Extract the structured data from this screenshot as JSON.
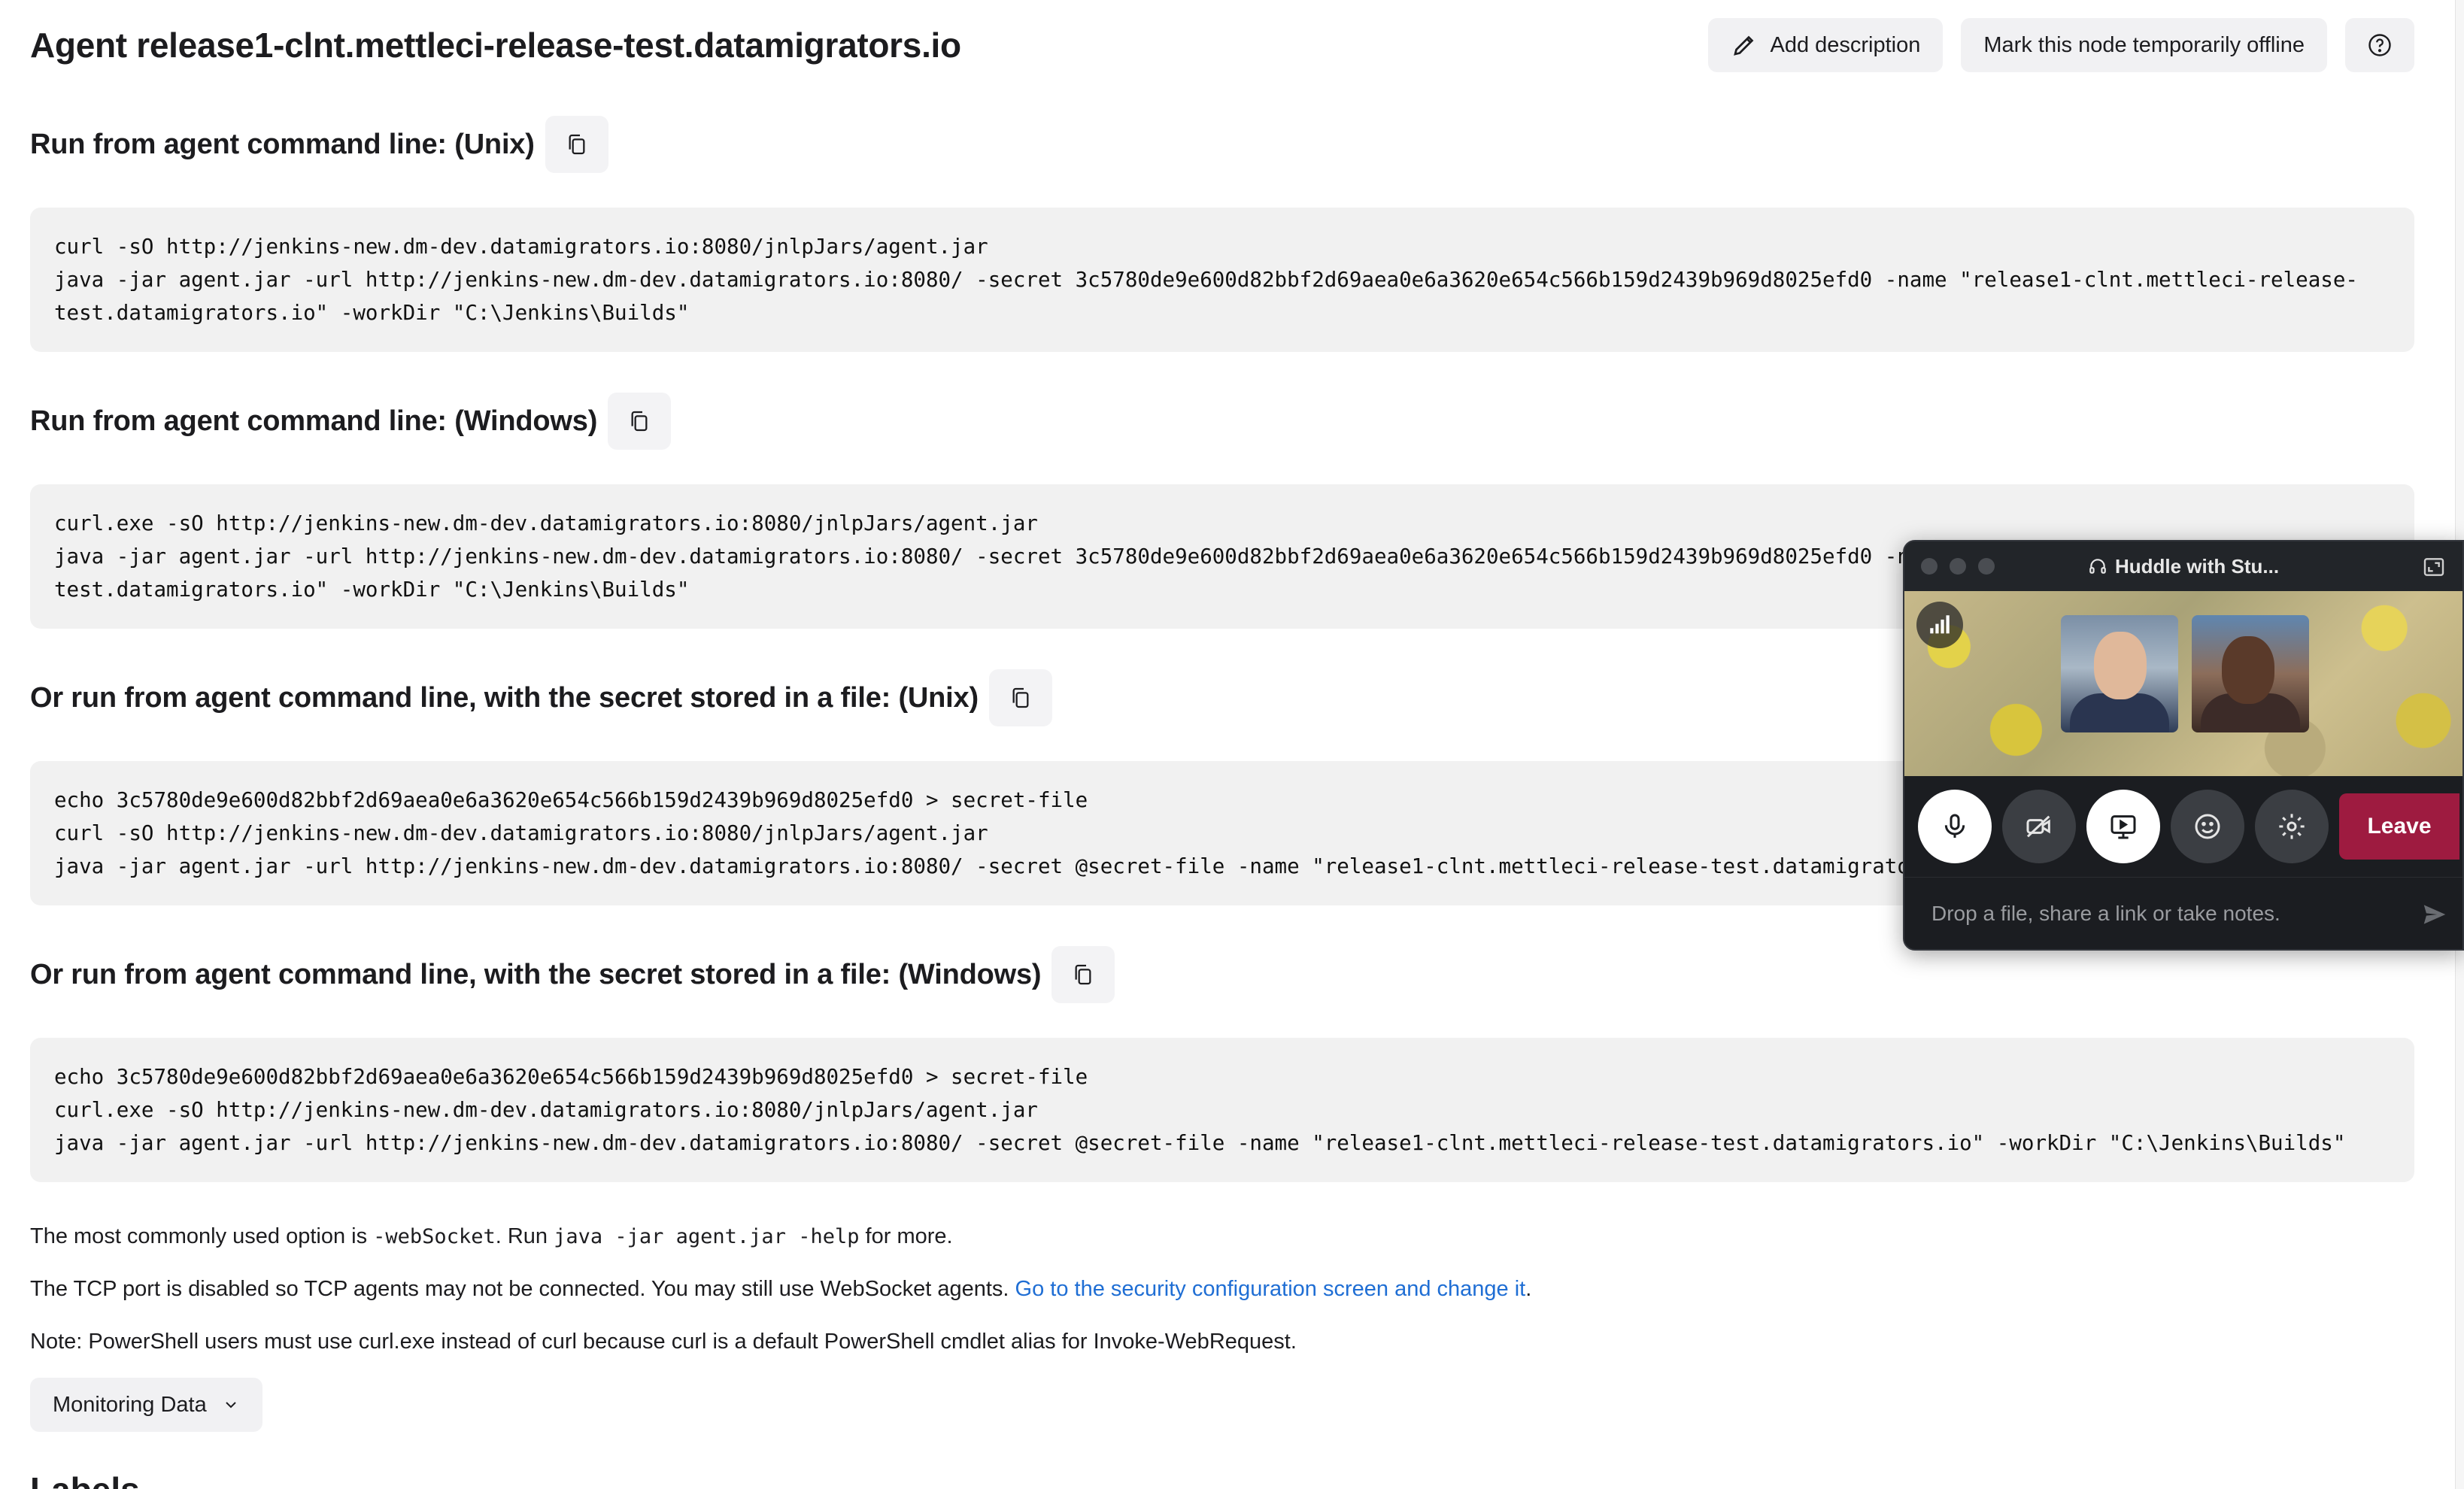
{
  "header": {
    "title": "Agent release1-clnt.mettleci-release-test.datamigrators.io",
    "add_description_label": "Add description",
    "offline_label": "Mark this node temporarily offline"
  },
  "sections": [
    {
      "title": "Run from agent command line: (Unix)",
      "code": "curl -sO http://jenkins-new.dm-dev.datamigrators.io:8080/jnlpJars/agent.jar\njava -jar agent.jar -url http://jenkins-new.dm-dev.datamigrators.io:8080/ -secret 3c5780de9e600d82bbf2d69aea0e6a3620e654c566b159d2439b969d8025efd0 -name \"release1-clnt.mettleci-release-\ntest.datamigrators.io\" -workDir \"C:\\Jenkins\\Builds\""
    },
    {
      "title": "Run from agent command line: (Windows)",
      "code": "curl.exe -sO http://jenkins-new.dm-dev.datamigrators.io:8080/jnlpJars/agent.jar\njava -jar agent.jar -url http://jenkins-new.dm-dev.datamigrators.io:8080/ -secret 3c5780de9e600d82bbf2d69aea0e6a3620e654c566b159d2439b969d8025efd0 -name \"release1-clnt.mettleci-release-\ntest.datamigrators.io\" -workDir \"C:\\Jenkins\\Builds\""
    },
    {
      "title": "Or run from agent command line, with the secret stored in a file: (Unix)",
      "code": "echo 3c5780de9e600d82bbf2d69aea0e6a3620e654c566b159d2439b969d8025efd0 > secret-file\ncurl -sO http://jenkins-new.dm-dev.datamigrators.io:8080/jnlpJars/agent.jar\njava -jar agent.jar -url http://jenkins-new.dm-dev.datamigrators.io:8080/ -secret @secret-file -name \"release1-clnt.mettleci-release-test.datamigrators.io\" -workDir \"C:\\Jenkins\\Builds\""
    },
    {
      "title": "Or run from agent command line, with the secret stored in a file: (Windows)",
      "code": "echo 3c5780de9e600d82bbf2d69aea0e6a3620e654c566b159d2439b969d8025efd0 > secret-file\ncurl.exe -sO http://jenkins-new.dm-dev.datamigrators.io:8080/jnlpJars/agent.jar\njava -jar agent.jar -url http://jenkins-new.dm-dev.datamigrators.io:8080/ -secret @secret-file -name \"release1-clnt.mettleci-release-test.datamigrators.io\" -workDir \"C:\\Jenkins\\Builds\""
    }
  ],
  "notes": {
    "websocket_prefix": "The most commonly used option is ",
    "websocket_code": "-webSocket",
    "websocket_mid": ". Run ",
    "websocket_code2": "java -jar agent.jar -help",
    "websocket_suffix": " for more.",
    "tcp_text": "The TCP port is disabled so TCP agents may not be connected. You may still use WebSocket agents. ",
    "tcp_link": "Go to the security configuration screen and change it",
    "tcp_end": ".",
    "powershell": "Note: PowerShell users must use curl.exe instead of curl because curl is a default PowerShell cmdlet alias for Invoke-WebRequest."
  },
  "monitoring_label": "Monitoring Data",
  "partial_heading": "Labels",
  "huddle": {
    "title": "Huddle with Stu...",
    "leave_label": "Leave",
    "input_placeholder": "Drop a file, share a link or take notes."
  },
  "colors": {
    "link": "#1f6ed4",
    "leave": "#9e1b40",
    "huddle_bg": "#1b1d21"
  }
}
